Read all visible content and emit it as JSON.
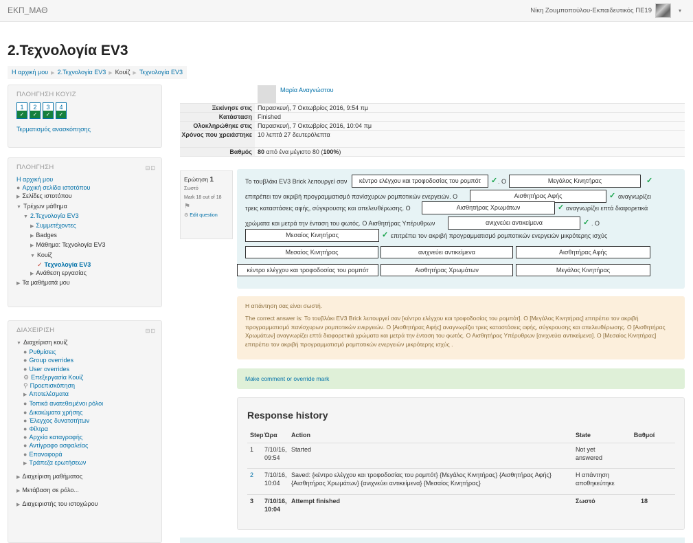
{
  "header": {
    "brand": "ΕΚΠ_ΜΑΘ",
    "user": "Νίκη Ζουμποπούλου-Εκπαιδευτικός ΠΕ19",
    "caret": "▾"
  },
  "page_title": "2.Τεχνολογία EV3",
  "breadcrumb": [
    "Η αρχική μου",
    "2.Τεχνολογία EV3",
    "Κουίζ",
    "Τεχνολογία EV3"
  ],
  "quiz_nav": {
    "title": "ΠΛΟΗΓΗΣΗ ΚΟΥΙΖ",
    "questions": [
      "1",
      "2",
      "3",
      "4"
    ],
    "check": "✓",
    "finish_link": "Τερματισμός ανασκόπησης"
  },
  "navigation": {
    "title": "ΠΛΟΗΓΗΣΗ",
    "controls": "⊟⊡",
    "items": [
      "Η αρχική μου",
      "Αρχική σελίδα ιστοτόπου",
      "Σελίδες ιστοτόπου",
      "Τρέχων μάθημα",
      "2.Τεχνολογία EV3",
      "Συμμετέχοντες",
      "Badges",
      "Μάθημα: Τεχνολογία EV3",
      "Κουίζ",
      "Τεχνολογία EV3",
      "Ανάθεση εργασίας",
      "Τα μαθήματά μου"
    ]
  },
  "admin": {
    "title": "ΔΙΑΧΕΙΡΙΣΗ",
    "controls": "⊟⊡",
    "items": [
      "Διαχείριση κουίζ",
      "Ρυθμίσεις",
      "Group overrides",
      "User overrides",
      "Επεξεργασία Κουίζ",
      "Προεπισκόπηση",
      "Αποτελέσματα",
      "Τοπικά ανατεθειμένοι ρόλοι",
      "Δικαιώματα χρήσης",
      "Έλεγχος δυνατοτήτων",
      "Φίλτρα",
      "Αρχεία καταγραφής",
      "Αντίγραφο ασφαλείας",
      "Επαναφορά",
      "Τράπεζα ερωτήσεων",
      "Διαχείριση μαθήματος",
      "Μετάβαση σε ρόλο...",
      "Διαχειριστής του ιστοχώρου"
    ]
  },
  "summary": {
    "student": "Μαρία Αναγνώστου",
    "rows": [
      {
        "k": "Ξεκίνησε στις",
        "v": "Παρασκευή, 7 Οκτωβρίος 2016, 9:54 πμ"
      },
      {
        "k": "Κατάσταση",
        "v": "Finished"
      },
      {
        "k": "Ολοκληρώθηκε στις",
        "v": "Παρασκευή, 7 Οκτωβρίος 2016, 10:04 πμ"
      },
      {
        "k": "Χρόνος που χρειάστηκε",
        "v": "10 λεπτά 27 δευτερόλεπτα"
      },
      {
        "k": "Βαθμός",
        "v": "από ένα μέγιστο 80 (100%)",
        "bold1": "80",
        "bold2": "100%"
      }
    ]
  },
  "question": {
    "label": "Ερώτηση",
    "number": "1",
    "status": "Σωστό",
    "mark": "Mark 18 out of 18",
    "flag": "⚑",
    "edit": "Edit question",
    "text": {
      "l1a": "Το τουβλάκι EV3 Brick λειτουργεί σαν",
      "l1b": ". Ο",
      "l2a": "επιτρέπει τον ακριβή προγραμματισμό πανίσχυρων ρομποτικών ενεργειών. Ο",
      "l2b": "αναγνωρίζει",
      "l3a": "τρεις καταστάσεις αφής, σύγκρουσης και απελευθέρωσης. Ο",
      "l3b": "αναγνωρίζει επτά διαφορετικά",
      "l4a": "χρώματα και μετρά την ένταση του φωτός. Ο Αισθητήρας Υπέρυθρων",
      "l4b": ". Ο",
      "l5": "επιτρέπει τον ακριβή προγραμματισμό ρομποτικών ενεργειών μικρότερης ισχύς"
    },
    "drops": [
      "κέντρο ελέγχου και τροφοδοσίας του ρομπότ",
      "Μεγάλος Κινητήρας",
      "Αισθητήρας Αφής",
      "Αισθητήρας Χρωμάτων",
      "ανιχνεύει αντικείμενα",
      "Μεσαίος Κινητήρας"
    ],
    "choices": [
      "Μεσαίος Κινητήρας",
      "ανιχνεύει αντικείμενα",
      "Αισθητήρας Αφής",
      "κέντρο ελέγχου και τροφοδοσίας του ρομπότ",
      "Αισθητήρας Χρωμάτων",
      "Μεγάλος Κινητήρας"
    ],
    "tick": "✓"
  },
  "feedback": {
    "status": "Η απάντηση σας είναι σωστή.",
    "correct": "The correct answer is: Το τουβλάκι EV3 Brick λειτουργεί σαν [κέντρο ελέγχου και τροφοδοσίας του ρομπότ]. Ο [Μεγάλος Κινητήρας] επιτρέπει τον ακριβή προγραμματισμό πανίσχυρων ρομποτικών ενεργειών. Ο [Αισθητήρας Αφής] αναγνωρίζει τρεις καταστάσεις αφής, σύγκρουσης και απελευθέρωσης. Ο [Αισθητήρας Χρωμάτων] αναγνωρίζει επτά διαφορετικά χρώματα και μετρά την ένταση του φωτός. Ο Αισθητήρας Υπέρυθρων [ανιχνεύει αντικείμενα]. Ο [Μεσαίος Κινητήρας] επιτρέπει τον ακριβή προγραμματισμό ρομποτικών ενεργειών μικρότερης ισχύς ."
  },
  "comment_link": "Make comment or override mark",
  "history": {
    "title": "Response history",
    "headers": [
      "Step",
      "Ώρα",
      "Action",
      "State",
      "Βαθμοί"
    ],
    "rows": [
      [
        "1",
        "7/10/16, 09:54",
        "Started",
        "Not yet answered",
        ""
      ],
      [
        "2",
        "7/10/16, 10:04",
        "Saved: {κέντρο ελέγχου και τροφοδοσίας του ρομπότ} {Μεγάλος Κινητήρας} {Αισθητήρας Αφής} {Αισθητήρας Χρωμάτων} {ανιχνεύει αντικείμενα} {Μεσαίος Κινητήρας}",
        "Η απάντηση αποθηκεύτηκε",
        ""
      ],
      [
        "3",
        "7/10/16, 10:04",
        "Attempt finished",
        "Σωστό",
        "18"
      ]
    ]
  }
}
